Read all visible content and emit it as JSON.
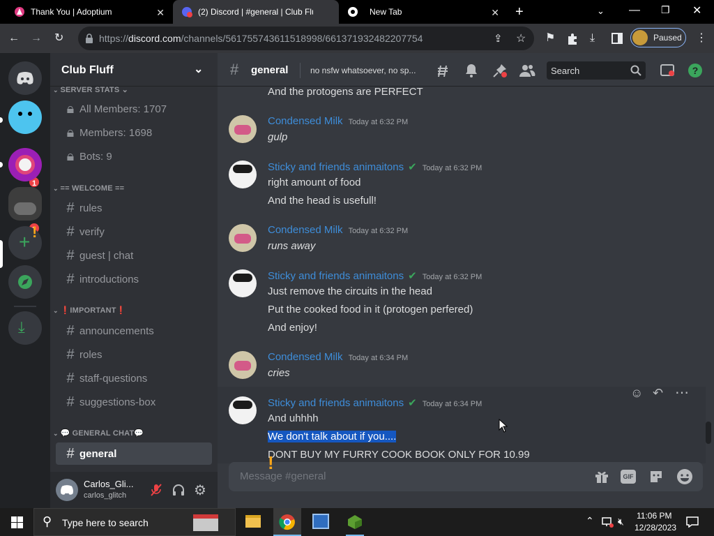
{
  "browser": {
    "tabs": [
      {
        "title": "Thank You | Adoptium",
        "active": false
      },
      {
        "title": "(2) Discord | #general | Club Fluff",
        "active": true
      },
      {
        "title": "New Tab",
        "active": false
      }
    ],
    "url_prefix": "https://",
    "url_domain": "discord.com",
    "url_path": "/channels/561755743611518998/661371932482207754",
    "profile_status": "Paused"
  },
  "server": {
    "name": "Club Fluff",
    "categories": {
      "stats": "SERVER STATS",
      "welcome": "== WELCOME ==",
      "important": "❗IMPORTANT❗",
      "general": "💬 GENERAL CHAT💬"
    },
    "stat_channels": [
      "All Members: 1707",
      "Members: 1698",
      "Bots: 9"
    ],
    "welcome_channels": [
      "rules",
      "verify",
      "guest | chat",
      "introductions"
    ],
    "important_channels": [
      "announcements",
      "roles",
      "staff-questions",
      "suggestions-box"
    ],
    "general_channels": [
      "general"
    ]
  },
  "guild_badges": [
    "1",
    "1"
  ],
  "user": {
    "display_name": "Carlos_Gli...",
    "username": "carlos_glitch"
  },
  "channel": {
    "name": "general",
    "topic": "no nsfw whatsoever, no sp...",
    "search_placeholder": "Search",
    "input_placeholder": "Message #general"
  },
  "messages": {
    "partial": "And the protogens are PERFECT",
    "m1": {
      "author": "Condensed Milk",
      "time": "Today at 6:32 PM",
      "lines": [
        "gulp"
      ]
    },
    "m2": {
      "author": "Sticky and friends animaitons",
      "time": "Today at 6:32 PM",
      "lines": [
        "right amount of food",
        "And the head is usefull!"
      ]
    },
    "m3": {
      "author": "Condensed Milk",
      "time": "Today at 6:32 PM",
      "lines": [
        "runs away"
      ]
    },
    "m4": {
      "author": "Sticky and friends animaitons",
      "time": "Today at 6:32 PM",
      "lines": [
        "Just remove the circuits in the head",
        "Put the cooked food in it (protogen perfered)",
        "And enjoy!"
      ]
    },
    "m5": {
      "author": "Condensed Milk",
      "time": "Today at 6:34 PM",
      "lines": [
        "cries"
      ]
    },
    "m6": {
      "author": "Sticky and friends animaitons",
      "time": "Today at 6:34 PM",
      "lines": [
        "And uhhhh",
        "We don't talk about if you....",
        "DONT BUY MY FURRY COOK BOOK ONLY FOR 10.99"
      ]
    }
  },
  "taskbar": {
    "search_placeholder": "Type here to search",
    "time": "11:06 PM",
    "date": "12/28/2023"
  },
  "colors": {
    "blurple": "#5865f2",
    "link_name": "#3e8dd9",
    "green": "#3ba55c",
    "red": "#ed4245",
    "selection": "#1557c0"
  },
  "icons": [
    "discord-logo-icon",
    "hash-icon",
    "lock-icon",
    "threads-icon",
    "bell-icon",
    "pin-icon",
    "members-icon",
    "search-icon",
    "inbox-icon",
    "help-icon",
    "gift-icon",
    "gif-icon",
    "sticker-icon",
    "emoji-icon",
    "mute-mic-icon",
    "headphones-icon",
    "gear-icon",
    "windows-start-icon"
  ]
}
